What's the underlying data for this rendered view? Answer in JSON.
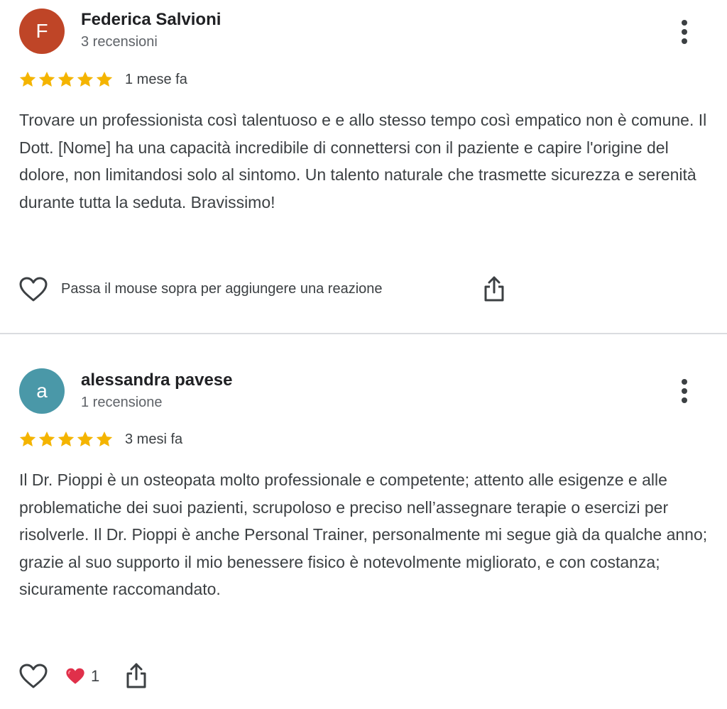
{
  "reviews": [
    {
      "avatar_letter": "F",
      "avatar_color": "#bf4527",
      "author": "Federica Salvioni",
      "review_count": "3 recensioni",
      "rating": 5,
      "date": "1 mese fa",
      "text": "Trovare un professionista così talentuoso e e allo stesso tempo così empatico non è comune. Il Dott. [Nome] ha una capacità incredibile di connettersi con il paziente e capire l'origine del dolore, non limitandosi solo al sintomo. Un talento naturale che trasmette sicurezza e serenità durante tutta la seduta. Bravissimo!",
      "reaction_hint": "Passa il mouse sopra per aggiungere una reazione"
    },
    {
      "avatar_letter": "a",
      "avatar_color": "#4a98a8",
      "author": "alessandra pavese",
      "review_count": "1 recensione",
      "rating": 5,
      "date": "3 mesi fa",
      "text": "Il Dr. Pioppi è un osteopata molto professionale e competente; attento alle esigenze e alle problematiche dei suoi pazienti, scrupoloso e preciso nell’assegnare terapie o esercizi per risolverle. Il Dr. Pioppi è anche Personal Trainer, personalmente mi segue già da qualche anno; grazie al suo supporto il mio benessere fisico è notevolmente migliorato, e con costanza; sicuramente raccomandato.",
      "reaction_emoji": "❤️",
      "reaction_count": "1"
    }
  ],
  "colors": {
    "star": "#f4b400",
    "divider": "#dadce0",
    "text_primary": "#202124",
    "text_secondary": "#5f6368"
  },
  "icons": {
    "more": "more-vert-icon",
    "heart": "heart-outline-icon",
    "share": "share-icon",
    "star": "star-icon"
  }
}
